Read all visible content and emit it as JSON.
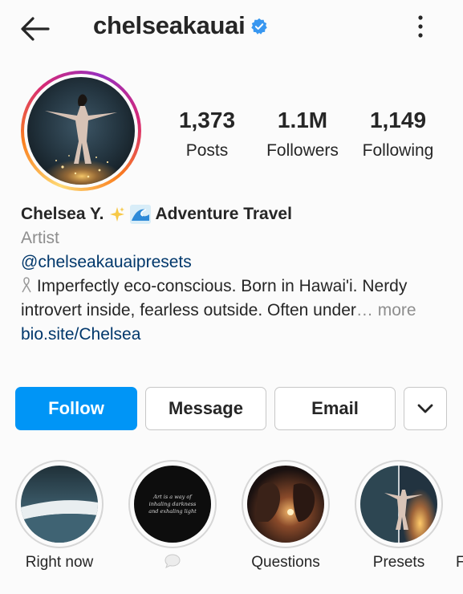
{
  "header": {
    "username": "chelseakauai",
    "back_icon": "arrow-left-icon",
    "verified_icon": "verified-badge-icon",
    "menu_icon": "more-vertical-icon"
  },
  "stats": [
    {
      "value": "1,373",
      "label": "Posts"
    },
    {
      "value": "1.1M",
      "label": "Followers"
    },
    {
      "value": "1,149",
      "label": "Following"
    }
  ],
  "bio": {
    "name": "Chelsea Y.",
    "name_suffix": "Adventure Travel",
    "name_emoji": [
      "sparkles-icon",
      "wave-icon"
    ],
    "category": "Artist",
    "handle": "@chelseakauaipresets",
    "line1": "Imperfectly eco-conscious. Born in Hawai'i. Nerdy",
    "line1_icon": "ribbon-icon",
    "line2": "introvert inside, fearless outside. Often under",
    "more": "… more",
    "link": "bio.site/Chelsea"
  },
  "buttons": {
    "follow": "Follow",
    "message": "Message",
    "email": "Email",
    "more_icon": "chevron-down-icon"
  },
  "highlights": [
    {
      "label": "Right now",
      "thumb_text": ""
    },
    {
      "label": "",
      "label_icon": "speech-bubble-icon",
      "thumb_text": "Art is a way of inhaling darkness and exhaling light"
    },
    {
      "label": "Questions",
      "thumb_text": ""
    },
    {
      "label": "Presets",
      "thumb_text": ""
    }
  ],
  "highlight_cut": "F",
  "colors": {
    "follow_blue": "#0095f6",
    "link_blue": "#00376b",
    "verified_blue": "#3897f0",
    "muted": "#8e8e8e"
  }
}
